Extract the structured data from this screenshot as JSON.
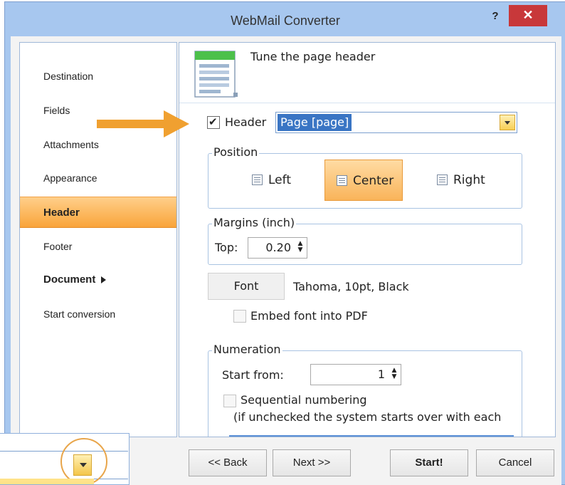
{
  "window": {
    "title": "WebMail Converter",
    "help_label": "?",
    "close_label": "✕"
  },
  "sidebar": {
    "items": [
      {
        "label": "Destination"
      },
      {
        "label": "Fields"
      },
      {
        "label": "Attachments"
      },
      {
        "label": "Appearance"
      },
      {
        "label": "Header",
        "active": true
      },
      {
        "label": "Footer"
      },
      {
        "label": "Document",
        "bold": true,
        "has_submenu": true
      },
      {
        "label": "Start conversion"
      }
    ]
  },
  "panel": {
    "title": "Tune the page header",
    "header_checkbox": {
      "label": "Header",
      "checked": true
    },
    "header_combo": {
      "value": "Page [page]"
    },
    "position": {
      "caption": "Position",
      "options": [
        {
          "label": "Left",
          "selected": false
        },
        {
          "label": "Center",
          "selected": true
        },
        {
          "label": "Right",
          "selected": false
        }
      ]
    },
    "margins": {
      "caption": "Margins (inch)",
      "top_label": "Top:",
      "top_value": "0.20"
    },
    "font": {
      "button_label": "Font",
      "description": "Tahoma, 10pt, Black"
    },
    "embed_font": {
      "label": "Embed font into PDF",
      "checked": false
    },
    "numeration": {
      "caption": "Numeration",
      "start_label": "Start from:",
      "start_value": "1",
      "sequential_label": "Sequential numbering",
      "sequential_note": "(if unchecked the system starts over with each",
      "sequential_checked": false
    }
  },
  "footer": {
    "back_label": "<< Back",
    "next_label": "Next >>",
    "start_label": "Start!",
    "cancel_label": "Cancel"
  },
  "colors": {
    "titlebar": "#a7c7ef",
    "close_button": "#c8383a",
    "active_nav": "#f9a43a",
    "selection_highlight": "#3a75c4",
    "arrow_annotation": "#f0a030"
  },
  "icons": [
    "help-icon",
    "close-icon",
    "document-header-icon",
    "checkbox-icon",
    "dropdown-arrow-icon",
    "align-left-icon",
    "align-center-icon",
    "align-right-icon",
    "spin-arrows-icon",
    "submenu-arrow-icon",
    "annotation-arrow-icon"
  ]
}
